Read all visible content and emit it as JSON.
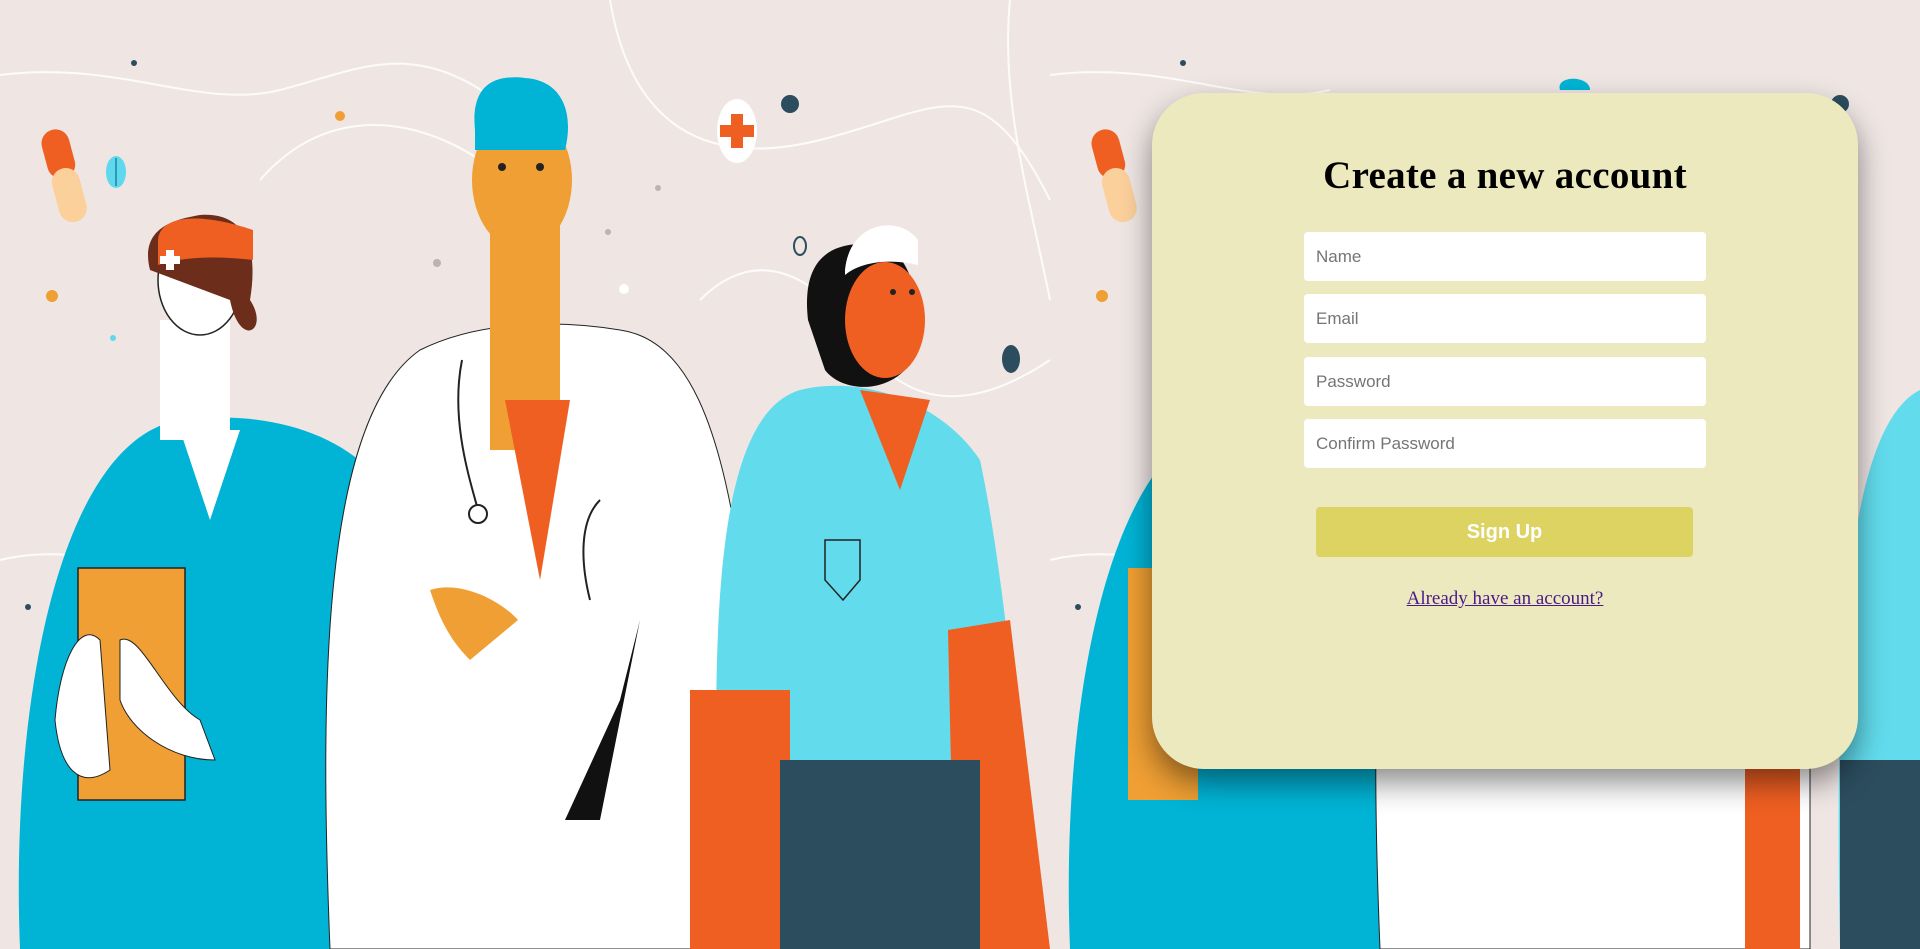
{
  "signup": {
    "title": "Create a new account",
    "name_placeholder": "Name",
    "email_placeholder": "Email",
    "password_placeholder": "Password",
    "confirm_placeholder": "Confirm Password",
    "submit_label": "Sign Up",
    "login_link": "Already have an account?"
  },
  "colors": {
    "page_background": "#efe6e4",
    "card_background": "#ede9be",
    "button_background": "#ddd363",
    "link": "#4a1a8a"
  },
  "background": {
    "illustration": "medical-staff-illustration"
  }
}
